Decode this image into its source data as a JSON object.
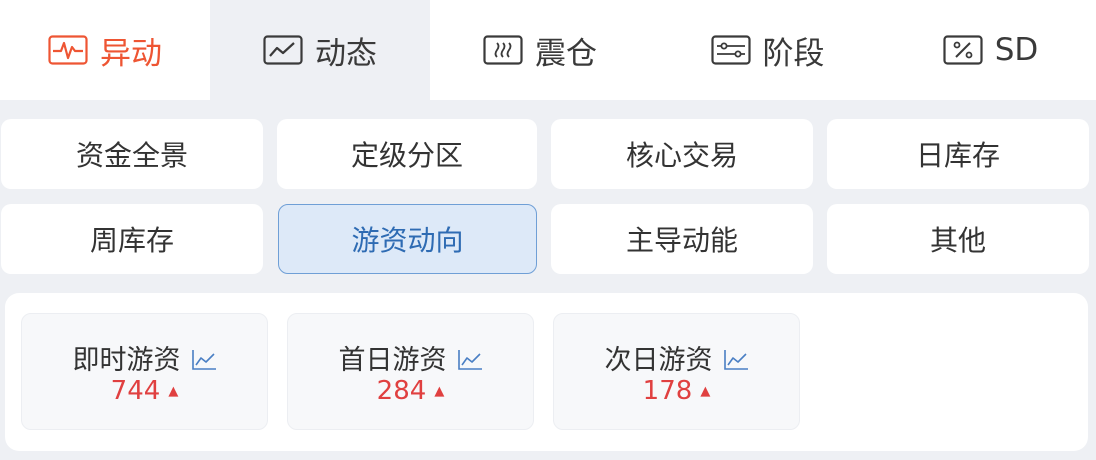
{
  "tabs": [
    {
      "label": "异动",
      "icon": "pulse-icon"
    },
    {
      "label": "动态",
      "icon": "trend-chart-icon"
    },
    {
      "label": "震仓",
      "icon": "vibration-icon"
    },
    {
      "label": "阶段",
      "icon": "timeline-icon"
    },
    {
      "label": "SD",
      "icon": "percent-icon"
    }
  ],
  "active_tab": "动态",
  "accent_color": "#ee5533",
  "categories": [
    "资金全景",
    "定级分区",
    "核心交易",
    "日库存",
    "周库存",
    "游资动向",
    "主导动能",
    "其他"
  ],
  "active_category": "游资动向",
  "cards": [
    {
      "label": "即时游资",
      "value": "744",
      "trend": "up",
      "icon": "line-chart-icon"
    },
    {
      "label": "首日游资",
      "value": "284",
      "trend": "up",
      "icon": "line-chart-icon"
    },
    {
      "label": "次日游资",
      "value": "178",
      "trend": "up",
      "icon": "line-chart-icon"
    }
  ],
  "up_color": "#e04040"
}
